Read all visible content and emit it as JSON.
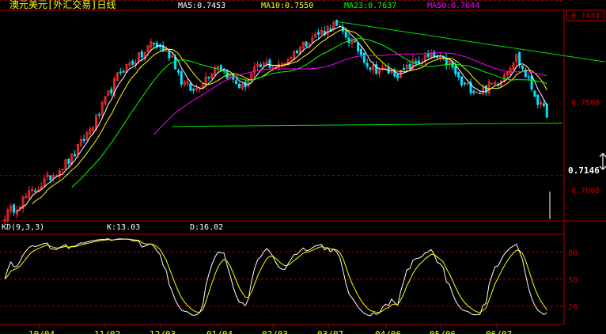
{
  "header": {
    "title": "澳元美元[外汇交易]日线",
    "ma5": "MA5:0.7453",
    "ma10": "MA10:0.7550",
    "ma23": "MA23:0.7637",
    "ma50": "MA50:0.7644"
  },
  "kd_header": {
    "name": "KD(9,3,3)",
    "k": "K:13.03",
    "d": "D:16.02"
  },
  "colors": {
    "bull": "#ff3030",
    "bear": "#00e5ff",
    "ma5": "#ffffff",
    "ma10": "#ffff00",
    "ma23": "#00ff00",
    "ma50": "#ff00ff",
    "trend": "#00e000",
    "grid": "#b00000",
    "title": "#ffff00",
    "axis_label": "#c00000",
    "k_line": "#ffffff",
    "d_line": "#ffff00",
    "badge_bg": "#ffffff",
    "badge_text": "#000000",
    "current_price_text": "#ffffff"
  },
  "chart_data": [
    {
      "type": "candlestick",
      "title": "澳元美元[外汇交易]日线",
      "ylim": [
        0.6875,
        0.747
      ],
      "y_ticks": [
        "0.7000",
        "0.7500"
      ],
      "top_price_badge": "0.7434",
      "current_price": "0.7146",
      "x_ticks": [
        "10/04",
        "11/02",
        "12/03",
        "01/04",
        "02/03",
        "03/07",
        "04/06",
        "05/06",
        "06/07"
      ],
      "series": [
        {
          "name": "MA5:0.7453"
        },
        {
          "name": "MA10:0.7550"
        },
        {
          "name": "MA23:0.7637"
        },
        {
          "name": "MA50:0.7644"
        }
      ],
      "waypoints": [
        [
          0,
          0.6885
        ],
        [
          6,
          0.693
        ],
        [
          14,
          0.699
        ],
        [
          22,
          0.705
        ],
        [
          30,
          0.716
        ],
        [
          38,
          0.73
        ],
        [
          46,
          0.735
        ],
        [
          48,
          0.738
        ],
        [
          52,
          0.736
        ],
        [
          55,
          0.734
        ],
        [
          58,
          0.727
        ],
        [
          62,
          0.724
        ],
        [
          66,
          0.728
        ],
        [
          70,
          0.732
        ],
        [
          74,
          0.728
        ],
        [
          78,
          0.725
        ],
        [
          82,
          0.73
        ],
        [
          86,
          0.732
        ],
        [
          90,
          0.731
        ],
        [
          96,
          0.736
        ],
        [
          100,
          0.739
        ],
        [
          104,
          0.741
        ],
        [
          108,
          0.743
        ],
        [
          112,
          0.74
        ],
        [
          116,
          0.736
        ],
        [
          120,
          0.731
        ],
        [
          124,
          0.73
        ],
        [
          130,
          0.729
        ],
        [
          134,
          0.732
        ],
        [
          140,
          0.734
        ],
        [
          146,
          0.732
        ],
        [
          150,
          0.726
        ],
        [
          156,
          0.724
        ],
        [
          162,
          0.727
        ],
        [
          168,
          0.734
        ],
        [
          172,
          0.727
        ],
        [
          176,
          0.7195
        ],
        [
          178,
          0.718
        ]
      ],
      "trend_upper": [
        [
          109,
          0.744
        ],
        [
          197,
          0.7325
        ]
      ],
      "trend_lower": [
        [
          55,
          0.714
        ],
        [
          183,
          0.715
        ]
      ]
    },
    {
      "type": "line",
      "title": "KD(9,3,3)",
      "ylim": [
        0,
        100
      ],
      "y_ticks": [
        "80",
        "50",
        "20"
      ],
      "series": [
        {
          "name": "K:13.03",
          "last": 13.03
        },
        {
          "name": "D:16.02",
          "last": 16.02
        }
      ]
    }
  ]
}
